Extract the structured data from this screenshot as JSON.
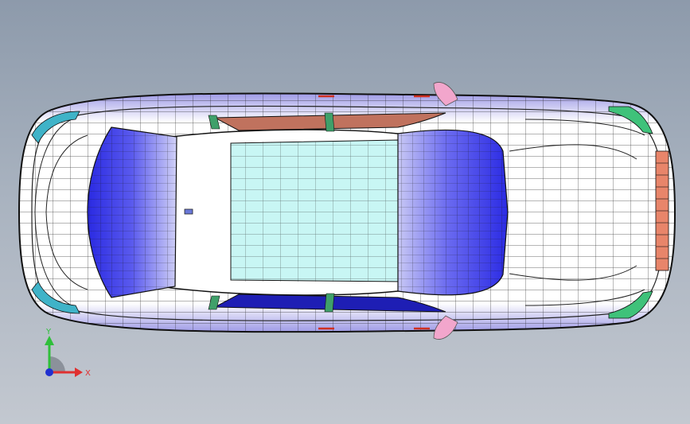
{
  "viewport": {
    "background_top": "#8d9aab",
    "background_bottom": "#c3c8d0"
  },
  "model": {
    "subject": "car-body-surface-mesh",
    "view": "top",
    "colors": {
      "body": "#ffffff",
      "mesh_line": "#1a1a1a",
      "windshield": "#2f2fe6",
      "rear_window": "#3434e8",
      "sunroof": "#c8f6f4",
      "side_window_left": "#c0725e",
      "side_window_right": "#1e1eb4",
      "mirror": "#f2a6cc",
      "light_teal": "#3fb3c8",
      "light_green": "#3fc27a",
      "tail_light": "#e8856a",
      "edge_shade": "#b8b6ee"
    }
  },
  "triad": {
    "y_label": "Y",
    "x_label": "X",
    "y_color": "#2fbf3a",
    "x_color": "#e03030",
    "origin_color": "#2030d0"
  }
}
